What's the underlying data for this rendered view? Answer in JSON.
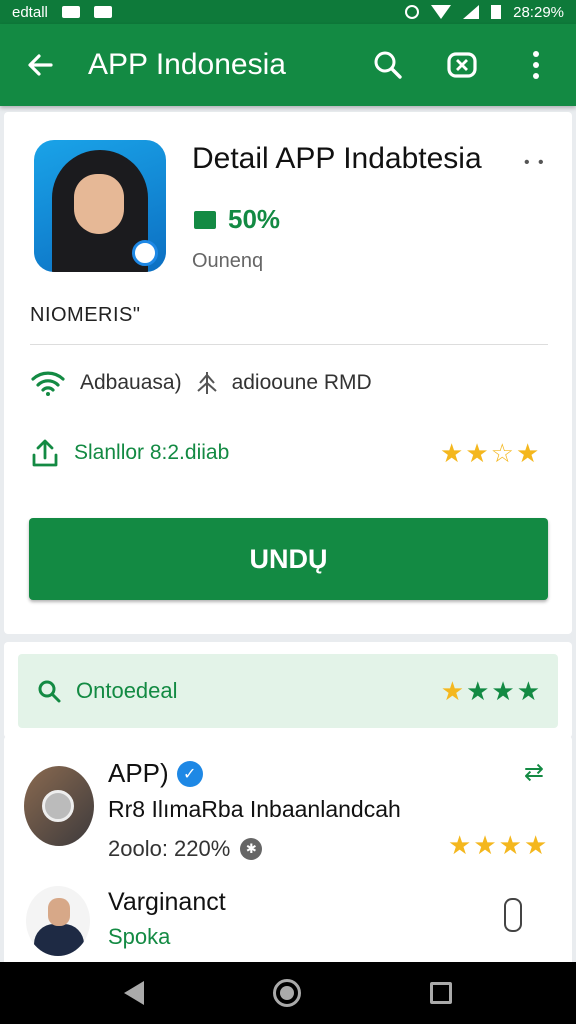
{
  "status_bar": {
    "carrier": "edtall",
    "time": "28:29%"
  },
  "app_bar": {
    "title": "APP Indonesia"
  },
  "detail": {
    "title": "Detail APP Indabtesia",
    "percent": "50%",
    "subtitle": "Ounenq",
    "label": "NIOMERIS\"",
    "info_left": "Adbauasa)",
    "info_right": "adiooune RMD",
    "share_text": "Slanllor 8:2.diiab",
    "rating_stars": 3.5,
    "download_label": "UNDŲ"
  },
  "search": {
    "text": "Ontoedeal",
    "rating_stars": 4
  },
  "reviews": [
    {
      "name": "APP)",
      "text": "Rr8 IlımaRba  Inbaanlandcah",
      "meta": "2oolo: 220%",
      "rating_stars": 4
    },
    {
      "name": "Varginanct",
      "sub": "Spoka"
    }
  ],
  "colors": {
    "primary": "#138a43",
    "primary_dark": "#0e7a3a",
    "star": "#f4b71e",
    "verified": "#1e88e5"
  }
}
